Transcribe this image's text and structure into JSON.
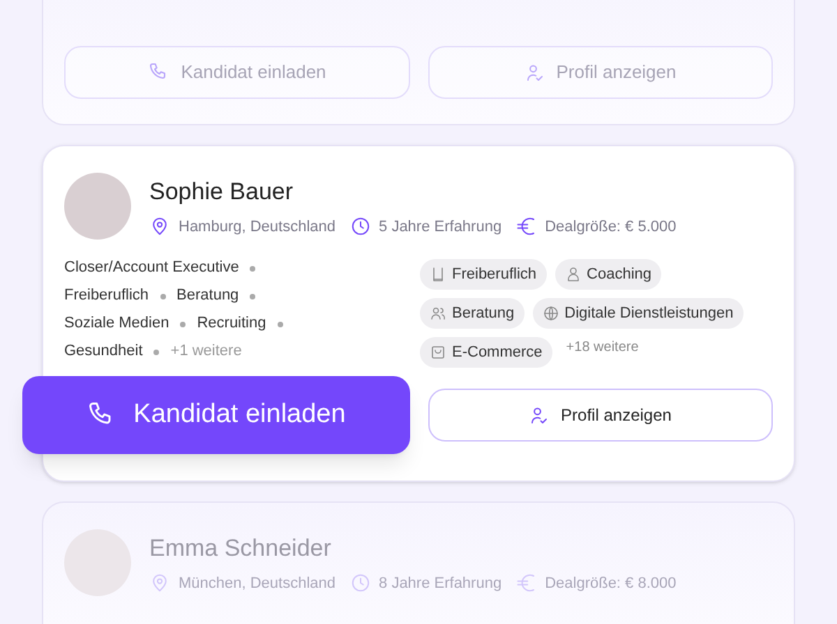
{
  "cards": [
    {
      "focused": false,
      "buttons": {
        "invite": "Kandidat einladen",
        "profile": "Profil anzeigen"
      }
    },
    {
      "focused": true,
      "name": "Sophie Bauer",
      "location": "Hamburg, Deutschland",
      "experience": "5 Jahre Erfahrung",
      "deal_size": "Dealgröße: € 5.000",
      "roles": [
        "Closer/Account Executive",
        "Freiberuflich",
        "Beratung",
        "Soziale Medien",
        "Recruiting",
        "Gesundheit"
      ],
      "roles_more": "+1 weitere",
      "tags": [
        {
          "label": "Freiberuflich",
          "kind": "freelance"
        },
        {
          "label": "Coaching",
          "kind": "person"
        },
        {
          "label": "Beratung",
          "kind": "people"
        },
        {
          "label": "Digitale Dienstleistungen",
          "kind": "globe"
        },
        {
          "label": "E-Commerce",
          "kind": "shop"
        }
      ],
      "tags_more": "+18 weitere",
      "buttons": {
        "invite": "Kandidat einladen",
        "profile": "Profil anzeigen"
      }
    },
    {
      "focused": false,
      "name": "Emma Schneider",
      "location": "München, Deutschland",
      "experience": "8 Jahre Erfahrung",
      "deal_size": "Dealgröße: € 8.000"
    }
  ]
}
